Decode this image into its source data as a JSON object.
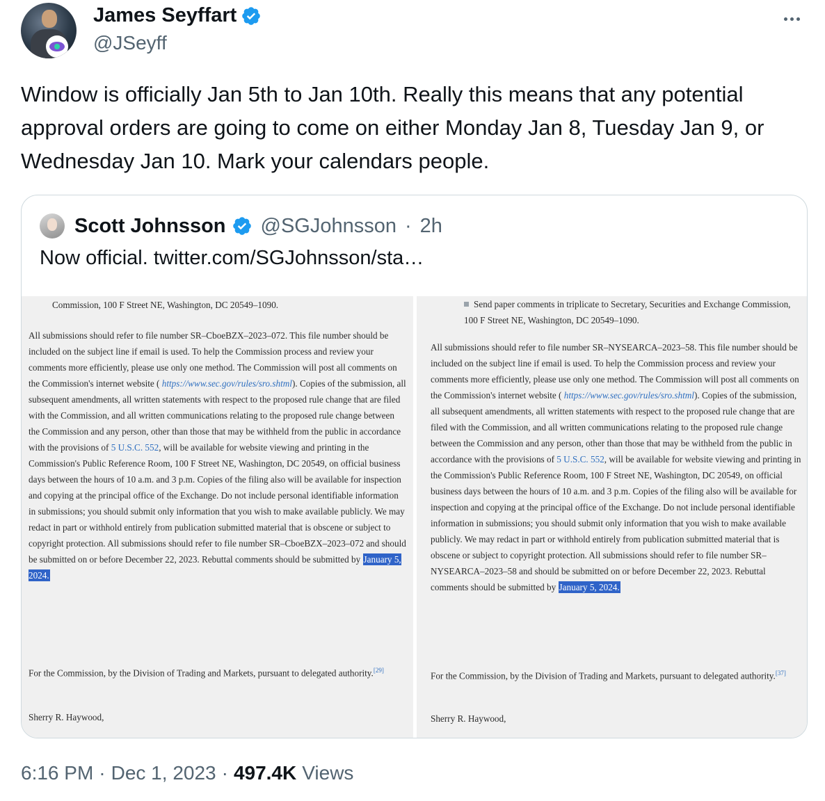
{
  "author": {
    "name": "James Seyffart",
    "handle": "@JSeyff",
    "avatar_badge": "eye-icon"
  },
  "tweet": {
    "text": "Window is officially Jan 5th to Jan 10th. Really this means that any potential approval orders are going to come on either Monday Jan 8, Tuesday Jan 9, or Wednesday Jan 10. Mark your calendars people.",
    "time": "6:16 PM",
    "date": "Dec 1, 2023",
    "views_count": "497.4K",
    "views_label": "Views"
  },
  "quote": {
    "name": "Scott Johnsson",
    "handle": "@SGJohnsson",
    "age": "2h",
    "text": "Now official.  twitter.com/SGJohnsson/sta…"
  },
  "doc_left": {
    "p0": "Commission, 100 F Street NE, Washington, DC 20549–1090.",
    "p1_a": "All submissions should refer to file number SR–CboeBZX–2023–072. This file number should be included on the subject line if email is used. To help the Commission process and review your comments more efficiently, please use only one method. The Commission will post all comments on the Commission's internet website ( ",
    "p1_link": "https://www.sec.gov/rules/sro.shtml",
    "p1_b": "). Copies of the submission, all subsequent amendments, all written statements with respect to the proposed rule change that are filed with the Commission, and all written communications relating to the proposed rule change between the Commission and any person, other than those that may be withheld from the public in accordance with the provisions of ",
    "p1_usc": "5 U.S.C. 552",
    "p1_c": ", will be available for website viewing and printing in the Commission's Public Reference Room, 100 F Street NE, Washington, DC 20549, on official business days between the hours of 10 a.m. and 3 p.m. Copies of the filing also will be available for inspection and copying at the principal office of the Exchange. Do not include personal identifiable information in submissions; you should submit only information that you wish to make available publicly. We may redact in part or withhold entirely from publication submitted material that is obscene or subject to copyright protection. All submissions should refer to file number SR–CboeBZX–2023–072 and should be submitted on or before December 22, 2023. Rebuttal comments should be submitted by ",
    "p1_hl": "January 5, 2024.",
    "p2": "For the Commission, by the Division of Trading and Markets, pursuant to delegated authority.",
    "p2_fn": "[29]",
    "p3": "Sherry R. Haywood,"
  },
  "doc_right": {
    "p0": "Send paper comments in triplicate to Secretary, Securities and Exchange Commission, 100 F Street NE, Washington, DC 20549–1090.",
    "p1_a": "All submissions should refer to file number SR–NYSEARCA–2023–58. This file number should be included on the subject line if email is used. To help the Commission process and review your comments more efficiently, please use only one method. The Commission will post all comments on the Commission's internet website ( ",
    "p1_link": "https://www.sec.gov/rules/sro.shtml",
    "p1_b": "). Copies of the submission, all subsequent amendments, all written statements with respect to the proposed rule change that are filed with the Commission, and all written communications relating to the proposed rule change between the Commission and any person, other than those that may be withheld from the public in accordance with the provisions of ",
    "p1_usc": "5 U.S.C. 552",
    "p1_c": ", will be available for website viewing and printing in the Commission's Public Reference Room, 100 F Street NE, Washington, DC 20549, on official business days between the hours of 10 a.m. and 3 p.m. Copies of the filing also will be available for inspection and copying at the principal office of the Exchange. Do not include personal identifiable information in submissions; you should submit only information that you wish to make available publicly. We may redact in part or withhold entirely from publication submitted material that is obscene or subject to copyright protection. All submissions should refer to file number SR–NYSEARCA–2023–58 and should be submitted on or before December 22, 2023. Rebuttal comments should be submitted by ",
    "p1_hl": "January 5, 2024.",
    "p2": "For the Commission, by the Division of Trading and Markets, pursuant to delegated authority.",
    "p2_fn": "[37]",
    "p3": "Sherry R. Haywood,"
  },
  "colors": {
    "verified": "#1d9bf0",
    "highlight": "#2f63c8",
    "link": "#2f6fbf"
  }
}
